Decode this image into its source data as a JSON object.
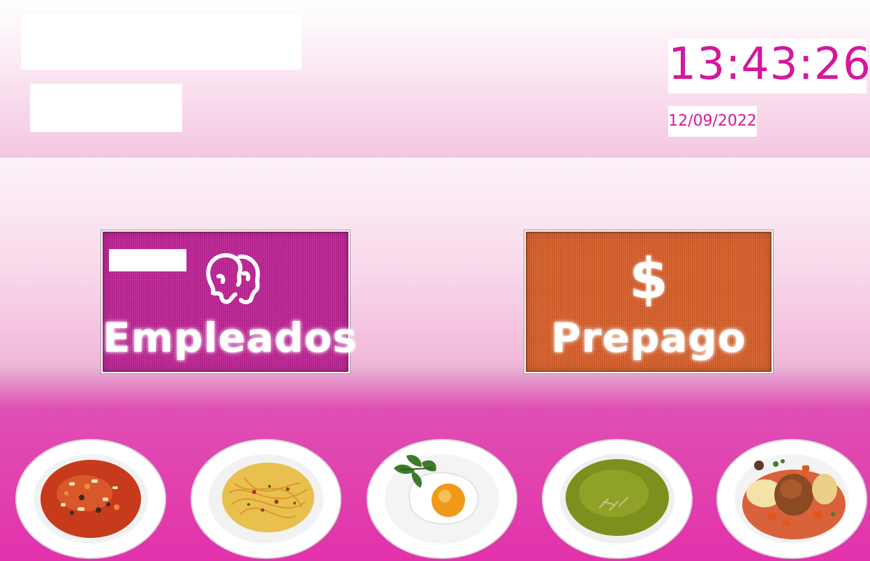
{
  "clock": {
    "time": "13:43:26",
    "date": "12/09/2022"
  },
  "buttons": {
    "empleados": {
      "label": "Empleados",
      "icon": "people-icon",
      "color": "#c5239a"
    },
    "prepago": {
      "label": "Prepago",
      "icon": "dollar-icon",
      "symbol": "$",
      "color": "#e0612a"
    }
  },
  "dishes": [
    {
      "icon": "vegetable-soup-icon"
    },
    {
      "icon": "spaghetti-icon"
    },
    {
      "icon": "fried-egg-icon"
    },
    {
      "icon": "cream-soup-icon"
    },
    {
      "icon": "chicken-stew-icon"
    }
  ],
  "colors": {
    "accent": "#d4189b",
    "bottom_band": "#e232ab"
  }
}
